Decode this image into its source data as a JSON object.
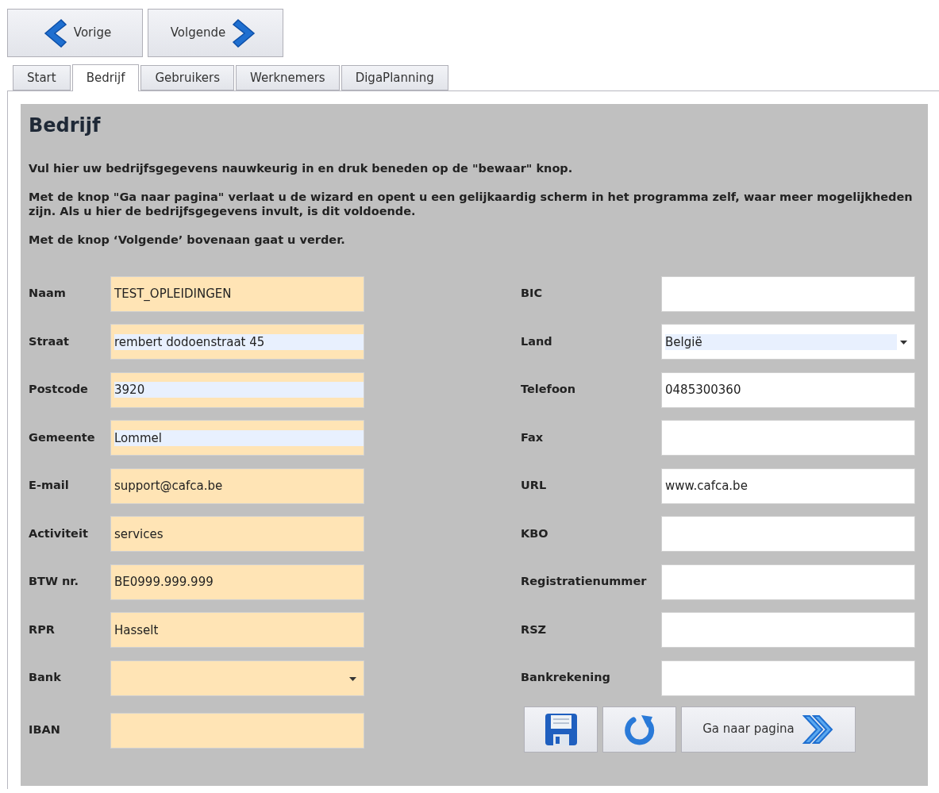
{
  "nav_buttons": [
    {
      "kind": "back",
      "label": "Vorige"
    },
    {
      "kind": "next",
      "label": "Volgende"
    }
  ],
  "tabs": [
    {
      "label": "Start",
      "selected": false
    },
    {
      "label": "Bedrijf",
      "selected": true
    },
    {
      "label": "Gebruikers",
      "selected": false
    },
    {
      "label": "Werknemers",
      "selected": false
    },
    {
      "label": "DigaPlanning",
      "selected": false
    }
  ],
  "heading": "Bedrijf",
  "intro": [
    "Vul hier uw bedrijfsgegevens nauwkeurig in en druk beneden op de \"bewaar\" knop.",
    "Met de knop \"Ga naar pagina\" verlaat u de wizard en opent u een gelijkaardig scherm in het programma zelf, waar meer mogelijkheden zijn. Als u hier de bedrijfsgegevens invult, is dit voldoende.",
    "Met de knop ‘Volgende’ bovenaan gaat u verder."
  ],
  "left_fields": [
    {
      "label": "Naam",
      "value": "TEST_OPLEIDINGEN",
      "kind": "text",
      "required": true,
      "autofilled": false
    },
    {
      "label": "Straat",
      "value": "rembert dodoenstraat 45",
      "kind": "text",
      "required": true,
      "autofilled": true
    },
    {
      "label": "Postcode",
      "value": "3920",
      "kind": "text",
      "required": true,
      "autofilled": true
    },
    {
      "label": "Gemeente",
      "value": "Lommel",
      "kind": "text",
      "required": true,
      "autofilled": true
    },
    {
      "label": "E-mail",
      "value": "support@cafca.be",
      "kind": "text",
      "required": true,
      "autofilled": false
    },
    {
      "label": "Activiteit",
      "value": "services",
      "kind": "text",
      "required": true,
      "autofilled": false
    },
    {
      "label": "BTW nr.",
      "value": "BE0999.999.999",
      "kind": "text",
      "required": true,
      "autofilled": false
    },
    {
      "label": "RPR",
      "value": "Hasselt",
      "kind": "text",
      "required": true,
      "autofilled": false
    },
    {
      "label": "Bank",
      "kind": "select",
      "required": true,
      "autofilled": false
    },
    {
      "label": "IBAN",
      "kind": "text",
      "required": true,
      "autofilled": false
    }
  ],
  "right_fields": [
    {
      "label": "BIC",
      "kind": "text",
      "required": false,
      "autofilled": false
    },
    {
      "label": "Land",
      "value": "België",
      "kind": "select",
      "required": false,
      "autofilled": true
    },
    {
      "label": "Telefoon",
      "value": "0485300360",
      "kind": "text",
      "required": false,
      "autofilled": false
    },
    {
      "label": "Fax",
      "kind": "text",
      "required": false,
      "autofilled": false
    },
    {
      "label": "URL",
      "value": "www.cafca.be",
      "kind": "text",
      "required": false,
      "autofilled": false
    },
    {
      "label": "KBO",
      "kind": "text",
      "required": false,
      "autofilled": false
    },
    {
      "label": "Registratienummer",
      "kind": "text",
      "required": false,
      "autofilled": false
    },
    {
      "label": "RSZ",
      "kind": "text",
      "required": false,
      "autofilled": false
    },
    {
      "label": "Bankrekening",
      "kind": "text",
      "required": false,
      "autofilled": false
    }
  ],
  "action_buttons": [
    {
      "kind": "save"
    },
    {
      "kind": "undo"
    },
    {
      "kind": "goto",
      "label": "Ga naar pagina"
    }
  ]
}
